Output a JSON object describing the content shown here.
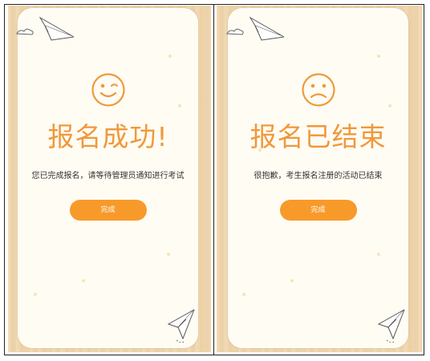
{
  "panels": [
    {
      "face": "wink-face-icon",
      "title": "报名成功!",
      "message": "您已完成报名，请等待管理员通知进行考试",
      "button_label": "完成"
    },
    {
      "face": "sad-face-icon",
      "title": "报名已结束",
      "message": "很抱歉，考生报名注册的活动已结束",
      "button_label": "完成"
    }
  ],
  "colors": {
    "accent": "#f0993a",
    "button": "#f89a2a",
    "card": "#fffcf4",
    "wood": "#f2d9b2"
  },
  "icons": [
    "paper-plane-icon",
    "cloud-icon",
    "wink-face-icon",
    "sad-face-icon"
  ]
}
